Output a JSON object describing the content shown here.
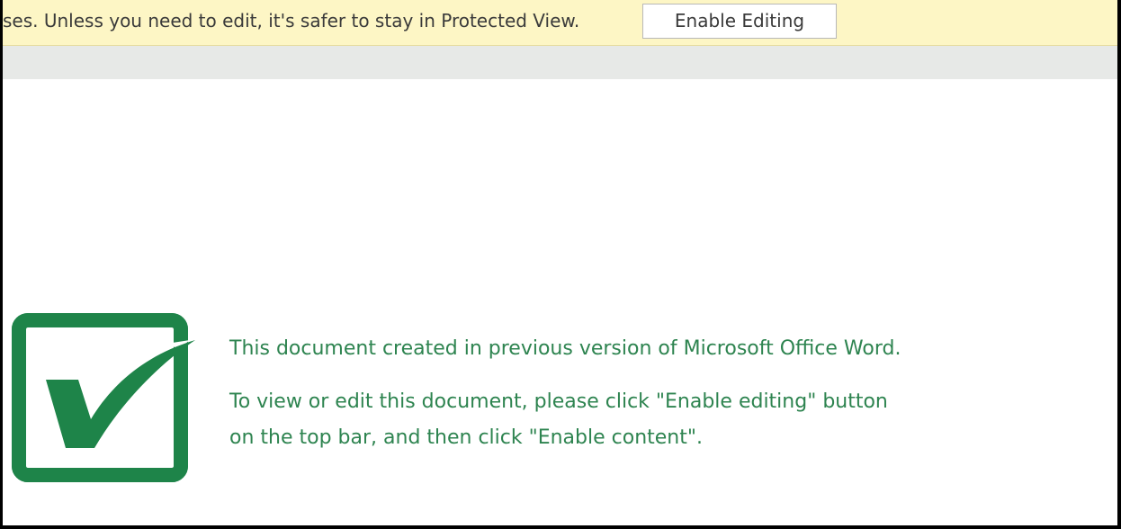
{
  "protected_view": {
    "message": "ses. Unless you need to edit, it's safer to stay in Protected View.",
    "enable_editing_label": "Enable Editing",
    "bar_color": "#fdf6c5"
  },
  "document": {
    "logo_icon": "green-checkbox-checkmark-icon",
    "accent_color": "#1e8449",
    "line1": "This document created in previous version of Microsoft Office Word.",
    "line2": "To view or edit this document, please click \"Enable editing\" button",
    "line3": "on the top bar, and then click \"Enable content\"."
  }
}
